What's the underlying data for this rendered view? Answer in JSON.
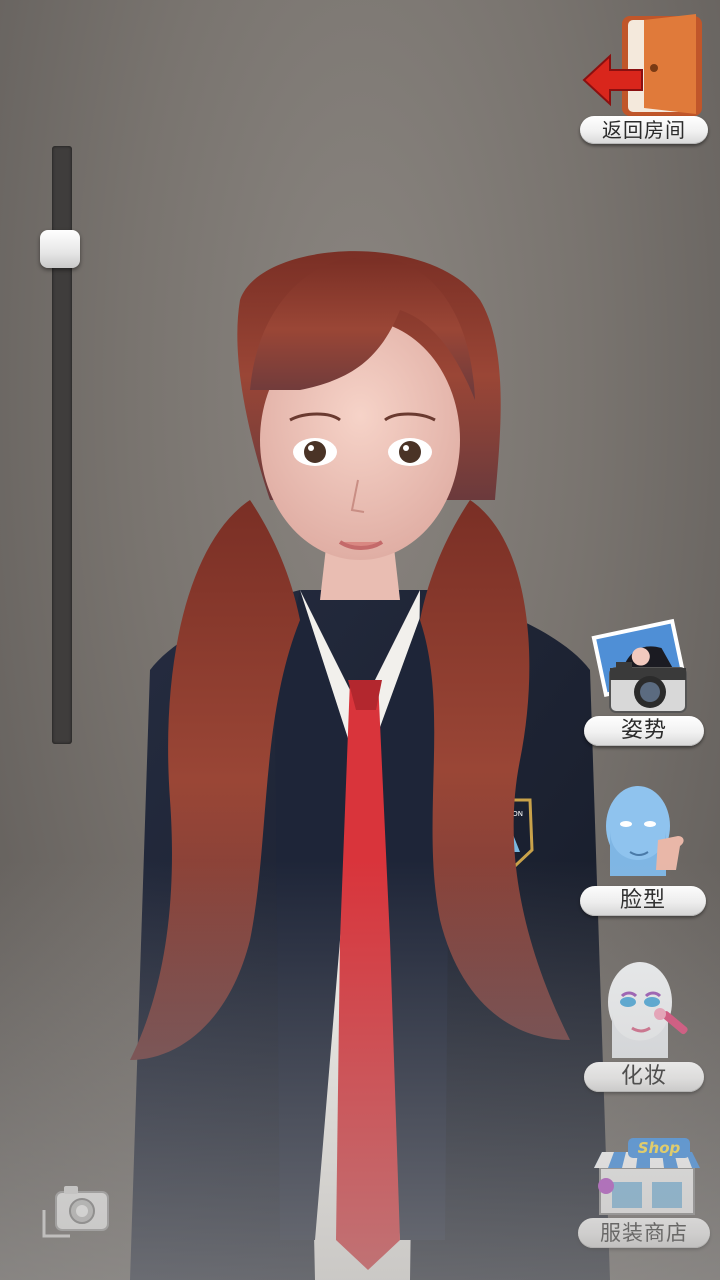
{
  "hud": {
    "back_room_label": "返回房间",
    "pose_label": "姿势",
    "face_label": "脸型",
    "makeup_label": "化妆",
    "shop_label": "服装商店",
    "shop_sign_text": "Shop",
    "badge_text": "SILVERMOON"
  },
  "zoom_slider": {
    "value": 0.15
  },
  "icons": {
    "back_room": "exit-door-icon",
    "pose": "camera-photo-icon",
    "face": "face-head-icon",
    "makeup": "makeup-head-icon",
    "shop": "shop-storefront-icon",
    "screenshot": "camera-icon"
  },
  "colors": {
    "background": "#79746f",
    "jacket": "#1c2233",
    "tie": "#d9343b",
    "hair": "#8a3b2e",
    "label_bg": "#f1f1f1",
    "door": "#e07a3a",
    "arrow": "#d9261c"
  }
}
